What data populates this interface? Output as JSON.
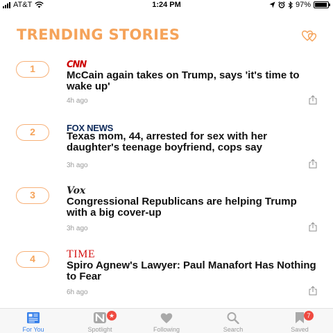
{
  "status_bar": {
    "carrier": "AT&T",
    "time": "1:24 PM",
    "battery_percent": "97%",
    "battery_level": 0.97,
    "icons": [
      "signal-icon",
      "wifi-icon",
      "location-icon",
      "alarm-icon",
      "bluetooth-icon",
      "battery-icon"
    ]
  },
  "header": {
    "title": "TRENDING STORIES",
    "icon": "hearts-icon"
  },
  "stories": [
    {
      "rank": "1",
      "source": "CNN",
      "headline": "McCain again takes on Trump, says 'it's time to wake up'",
      "age": "4h ago"
    },
    {
      "rank": "2",
      "source": "FOX NEWS",
      "headline": "Texas mom, 44, arrested for sex with her daughter's teenage boyfriend, cops say",
      "age": "3h ago"
    },
    {
      "rank": "3",
      "source": "Vox",
      "headline": "Congressional Republicans are helping Trump with a big cover-up",
      "age": "3h ago"
    },
    {
      "rank": "4",
      "source": "TIME",
      "headline": "Spiro Agnew's Lawyer: Paul Manafort Has Nothing to Fear",
      "age": "6h ago"
    }
  ],
  "tabs": [
    {
      "label": "For You",
      "icon": "news-icon",
      "active": true
    },
    {
      "label": "Spotlight",
      "icon": "spotlight-icon",
      "badge": "★"
    },
    {
      "label": "Following",
      "icon": "heart-icon"
    },
    {
      "label": "Search",
      "icon": "search-icon"
    },
    {
      "label": "Saved",
      "icon": "bookmark-icon",
      "badge": "7"
    }
  ],
  "colors": {
    "accent_orange": "#f5a35a",
    "tab_active_blue": "#3a82ea",
    "badge_red": "#ef4a40",
    "cnn_red": "#cc0000",
    "fox_navy": "#0e2a5a",
    "time_red": "#d51515"
  }
}
